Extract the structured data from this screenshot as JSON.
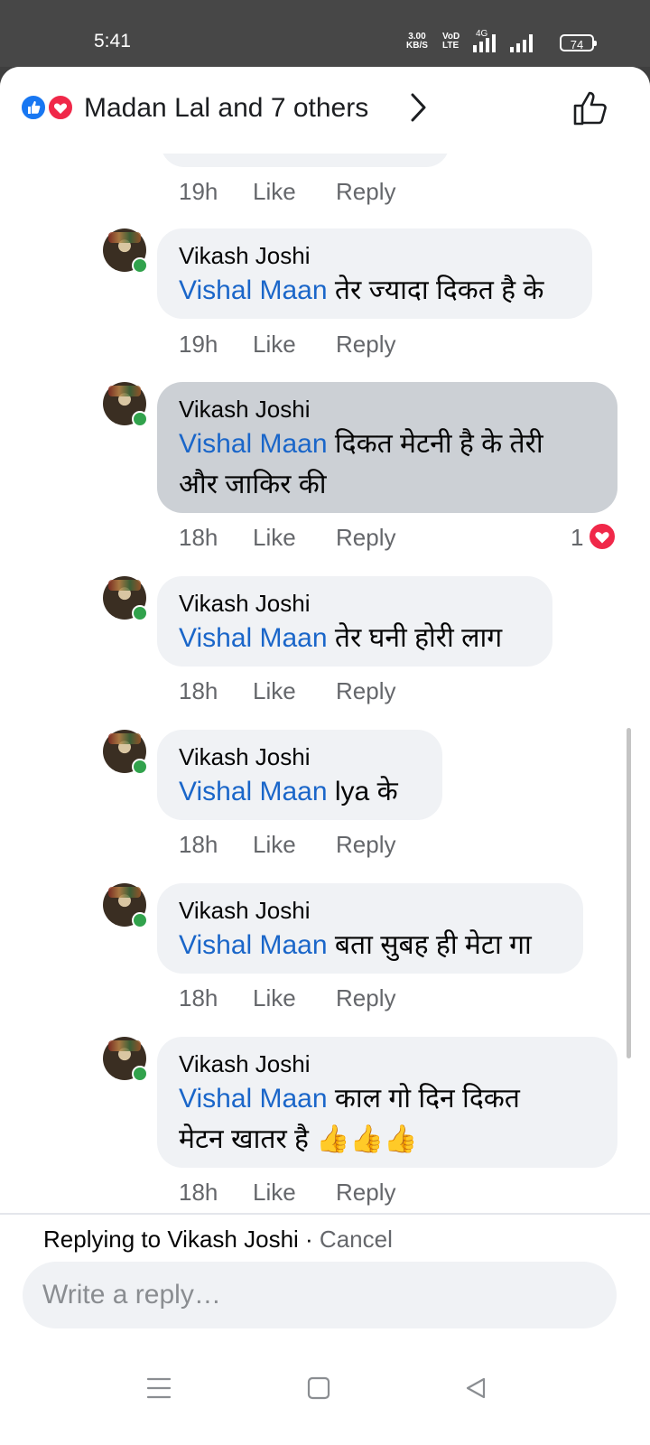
{
  "status_bar": {
    "time": "5:41",
    "net_speed": "3.00",
    "net_unit": "KB/S",
    "volte_top": "VoD",
    "volte_bottom": "LTE",
    "net_type": "4G",
    "battery": "74"
  },
  "header": {
    "reactions_text": "Madan Lal and 7 others"
  },
  "top_meta": {
    "time": "19h",
    "like": "Like",
    "reply": "Reply"
  },
  "comments": [
    {
      "author": "Vikash Joshi",
      "mention": "Vishal Maan",
      "text_line1": " तेर ज्यादा दिकत है के",
      "text_line2": "",
      "time": "19h",
      "like": "Like",
      "reply": "Reply"
    },
    {
      "author": "Vikash Joshi",
      "mention": "Vishal Maan",
      "text_line1": " दिकत  मेटनी है के तेरी",
      "text_line2": "और जाकिर की",
      "time": "18h",
      "like": "Like",
      "reply": "Reply",
      "reaction_count": "1"
    },
    {
      "author": "Vikash Joshi",
      "mention": "Vishal Maan",
      "text_line1": " तेर घनी होरी लाग",
      "text_line2": "",
      "time": "18h",
      "like": "Like",
      "reply": "Reply"
    },
    {
      "author": "Vikash Joshi",
      "mention": "Vishal Maan",
      "text_line1": " lya के",
      "text_line2": "",
      "time": "18h",
      "like": "Like",
      "reply": "Reply"
    },
    {
      "author": "Vikash Joshi",
      "mention": "Vishal Maan",
      "text_line1": " बता सुबह ही मेटा गा",
      "text_line2": "",
      "time": "18h",
      "like": "Like",
      "reply": "Reply"
    },
    {
      "author": "Vikash Joshi",
      "mention": "Vishal Maan",
      "text_line1": " काल गो दिन दिकत",
      "text_line2": "मेटन खातर है 👍👍👍",
      "time": "18h",
      "like": "Like",
      "reply": "Reply"
    }
  ],
  "composer": {
    "replying_prefix": "Replying to ",
    "replying_name": "Vikash Joshi",
    "separator": " · ",
    "cancel": "Cancel",
    "placeholder": "Write a reply…"
  },
  "colors": {
    "link": "#1a66c9",
    "bubble": "#f0f2f5",
    "selected_bubble": "#ccd0d5",
    "like_blue": "#1877f2",
    "love_red": "#f02849"
  }
}
